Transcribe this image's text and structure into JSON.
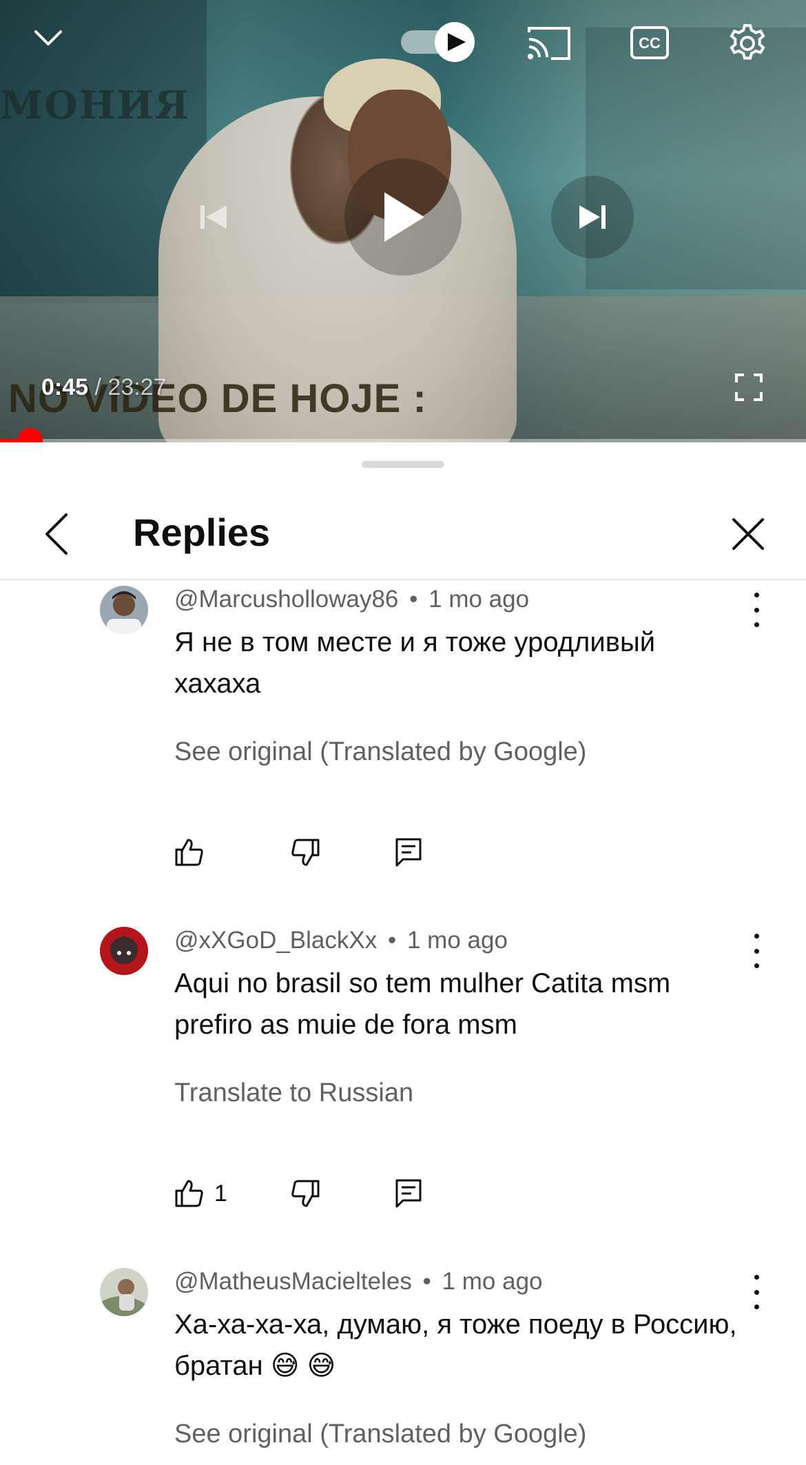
{
  "player": {
    "time_current": "0:45",
    "time_duration": "/ 23:27",
    "overlay_caption": "NO VÍDEO DE HOJE :",
    "sign_text": "МОНИЯ",
    "progress_fraction": 0.038,
    "accent_color": "#ff0000"
  },
  "header": {
    "title": "Replies"
  },
  "comments": [
    {
      "author": "@Marcusholloway86",
      "time": "1 mo ago",
      "text": "Я не в том месте и я тоже уродливый хахаха",
      "translate_label": "See original (Translated by Google)",
      "likes": ""
    },
    {
      "author": "@xXGoD_BlackXx",
      "time": "1 mo ago",
      "text": "Aqui no brasil so tem mulher Catita msm prefiro as muie de fora msm",
      "translate_label": "Translate to Russian",
      "likes": "1"
    },
    {
      "author": "@MatheusMacielteles",
      "time": "1 mo ago",
      "text": "Ха-ха-ха-ха, думаю, я тоже поеду в Россию, братан 😅 😅",
      "translate_label": "See original (Translated by Google)",
      "likes": ""
    }
  ],
  "separator": "•"
}
